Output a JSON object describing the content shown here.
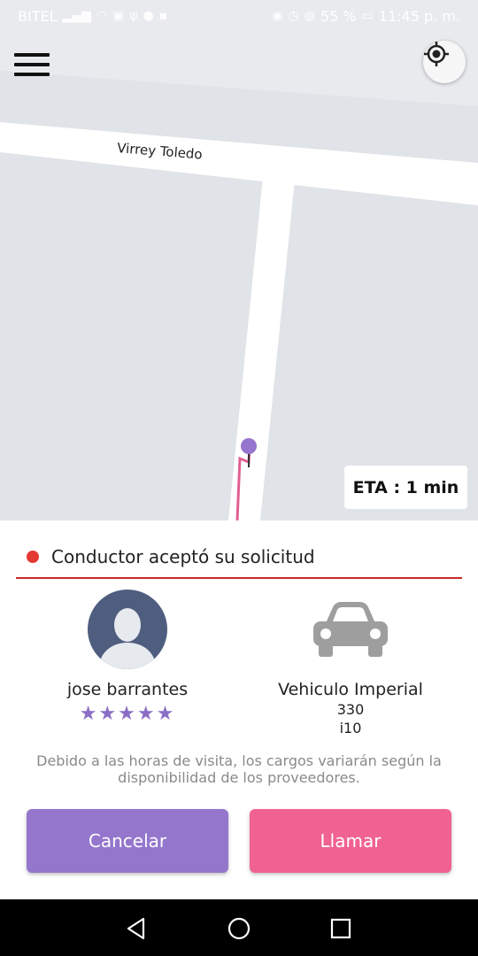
{
  "status_bar": {
    "carrier": "BITEL",
    "battery": "55 %",
    "time": "11:45 p. m."
  },
  "map": {
    "street_label": "Virrey Toledo",
    "eta_text": "ETA : 1 min",
    "marker_color": "#9575cd",
    "route_color": "#e06090"
  },
  "panel": {
    "status_text": "Conductor aceptó su solicitud",
    "driver": {
      "name": "jose barrantes",
      "rating": 5,
      "stars": "★★★★★"
    },
    "vehicle": {
      "name": "Vehiculo Imperial",
      "number": "330",
      "model": "i10"
    },
    "notice": "Debido a las horas de visita, los cargos variarán según la disponibilidad de los proveedores.",
    "buttons": {
      "cancel_label": "Cancelar",
      "call_label": "Llamar"
    }
  },
  "colors": {
    "accent_purple": "#9476cc",
    "accent_pink": "#f06291",
    "status_red": "#e53935"
  },
  "icons": {
    "menu": "hamburger-menu-icon",
    "locate": "my-location-icon",
    "back": "back-triangle-icon",
    "home": "home-circle-icon",
    "recents": "recents-square-icon"
  }
}
